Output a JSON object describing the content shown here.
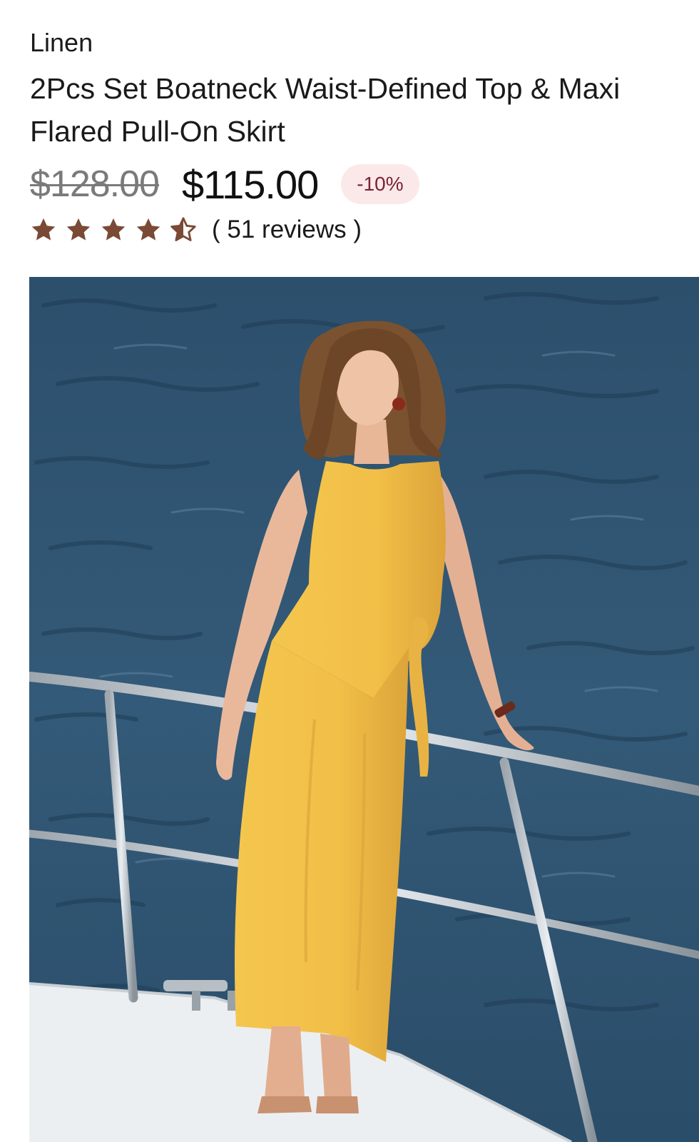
{
  "product": {
    "category": "Linen",
    "title": "2Pcs Set Boatneck Waist-Defined Top & Maxi Flared Pull-On Skirt",
    "original_price": "$128.00",
    "sale_price": "$115.00",
    "discount": "-10%",
    "rating": 4.5,
    "rating_max": 5,
    "reviews_text": "( 51 reviews )"
  },
  "colors": {
    "star": "#7a4a35",
    "badge_bg": "#fbe9ea",
    "badge_text": "#7a2430",
    "dress": "#f2c04a",
    "sea": "#2f5470"
  },
  "image": {
    "description_icon": "product-photo-yellow-linen-set-on-boat"
  }
}
